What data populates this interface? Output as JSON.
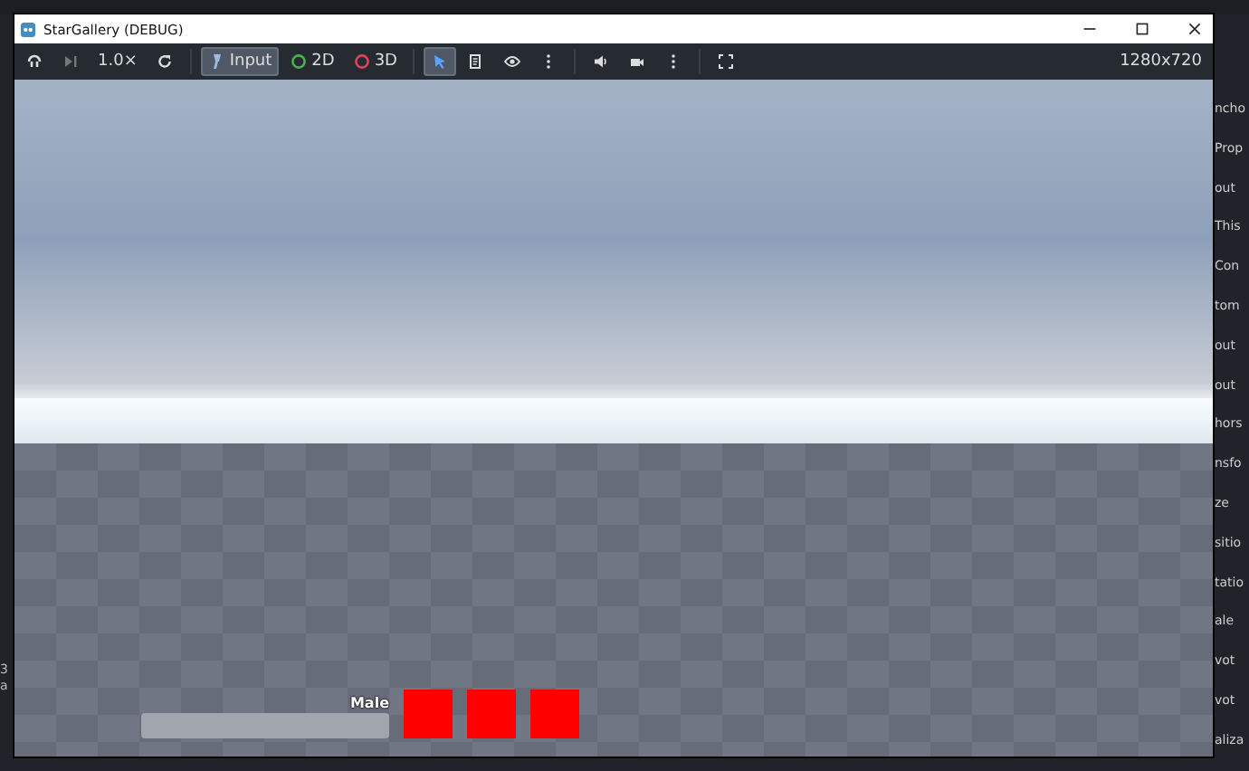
{
  "editor": {
    "inspector_rows": [
      "ncho",
      "Prop",
      "out",
      "This",
      "Con",
      "tom",
      "out",
      "out",
      "hors",
      "nsfo",
      "ze",
      "sitio",
      "tatio",
      "ale",
      "vot",
      "vot",
      "aliza"
    ],
    "left_rows": [
      "3",
      "a"
    ]
  },
  "window": {
    "title": "StarGallery (DEBUG)"
  },
  "toolbar": [
    {
      "kind": "icon",
      "selected": false
    },
    {
      "kind": "icon",
      "selected": false
    },
    {
      "kind": "text",
      "label": "1.0×",
      "selected": false
    },
    {
      "kind": "icon",
      "selected": false
    },
    {
      "kind": "sep"
    },
    {
      "kind": "labeled",
      "label": "Input",
      "selected": true
    },
    {
      "kind": "radio",
      "label": "2D",
      "color": "#4caf50",
      "selected": false
    },
    {
      "kind": "radio",
      "label": "3D",
      "color": "#e0445a",
      "selected": false
    },
    {
      "kind": "sep"
    },
    {
      "kind": "icon",
      "selected": true
    },
    {
      "kind": "icon",
      "selected": false
    },
    {
      "kind": "icon",
      "selected": false
    },
    {
      "kind": "icon",
      "selected": false
    },
    {
      "kind": "sep"
    },
    {
      "kind": "icon",
      "selected": false
    },
    {
      "kind": "icon",
      "selected": false
    },
    {
      "kind": "icon",
      "selected": false
    },
    {
      "kind": "sep"
    },
    {
      "kind": "icon",
      "selected": false
    }
  ],
  "resolution": "1280x720",
  "hud": {
    "label": "Male",
    "slots": [
      {
        "color": "#ff0000"
      },
      {
        "color": "#ff0000"
      },
      {
        "color": "#ff0000"
      }
    ]
  }
}
